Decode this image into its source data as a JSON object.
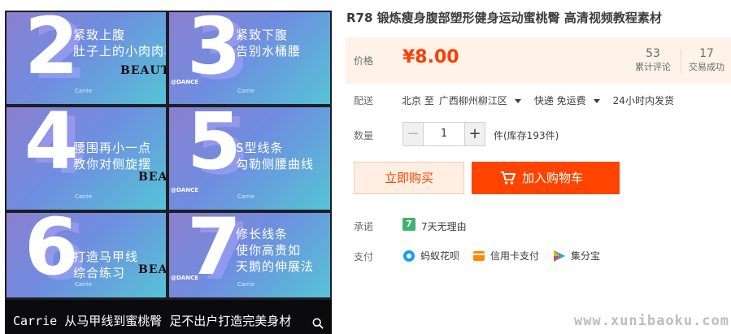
{
  "gallery": {
    "tiles": [
      {
        "num": "2",
        "caption": "紧致上腹\n肚子上的小肉肉再见"
      },
      {
        "num": "3",
        "caption": "紧致下腹\n告别水桶腰"
      },
      {
        "num": "4",
        "caption": "腰围再小一点\n教你对侧旋摆"
      },
      {
        "num": "5",
        "caption": "S型线条\n勾勒侧腰曲线"
      },
      {
        "num": "6",
        "caption": "打造马甲线\n综合练习"
      },
      {
        "num": "7",
        "caption": "修长线条\n使你高贵如\n天鹅的伸展法"
      }
    ],
    "signature": "Carrie",
    "beauty_text": "BEAUTY",
    "dance_text": "@DANCE",
    "banner": "Carrie 从马甲线到蜜桃臀 足不出户打造完美身材"
  },
  "product": {
    "title": "R78 锻炼瘦身腹部塑形健身运动蜜桃臀 高清视频教程素材",
    "price_label": "价格",
    "price": "¥8.00",
    "reviews_count": "53",
    "reviews_label": "累计评论",
    "sales_count": "17",
    "sales_label": "交易成功"
  },
  "shipping": {
    "label": "配送",
    "origin": "北京 至",
    "destination": "广西柳州柳江区",
    "method": "快递 免运费",
    "dispatch": "24小时内发货"
  },
  "quantity": {
    "label": "数量",
    "minus": "−",
    "value": "1",
    "plus": "+",
    "stock": "件(库存193件)"
  },
  "actions": {
    "buy_now": "立即购买",
    "add_to_cart": "加入购物车"
  },
  "promise": {
    "label": "承诺",
    "badge": "7",
    "text": "7天无理由"
  },
  "payment": {
    "label": "支付",
    "methods": [
      "蚂蚁花呗",
      "信用卡支付",
      "集分宝"
    ]
  },
  "watermark": "www.xunibaoku.com",
  "colors": {
    "accent": "#ff4400",
    "price": "#ff3c00",
    "price_bg": "#fff2e8"
  }
}
